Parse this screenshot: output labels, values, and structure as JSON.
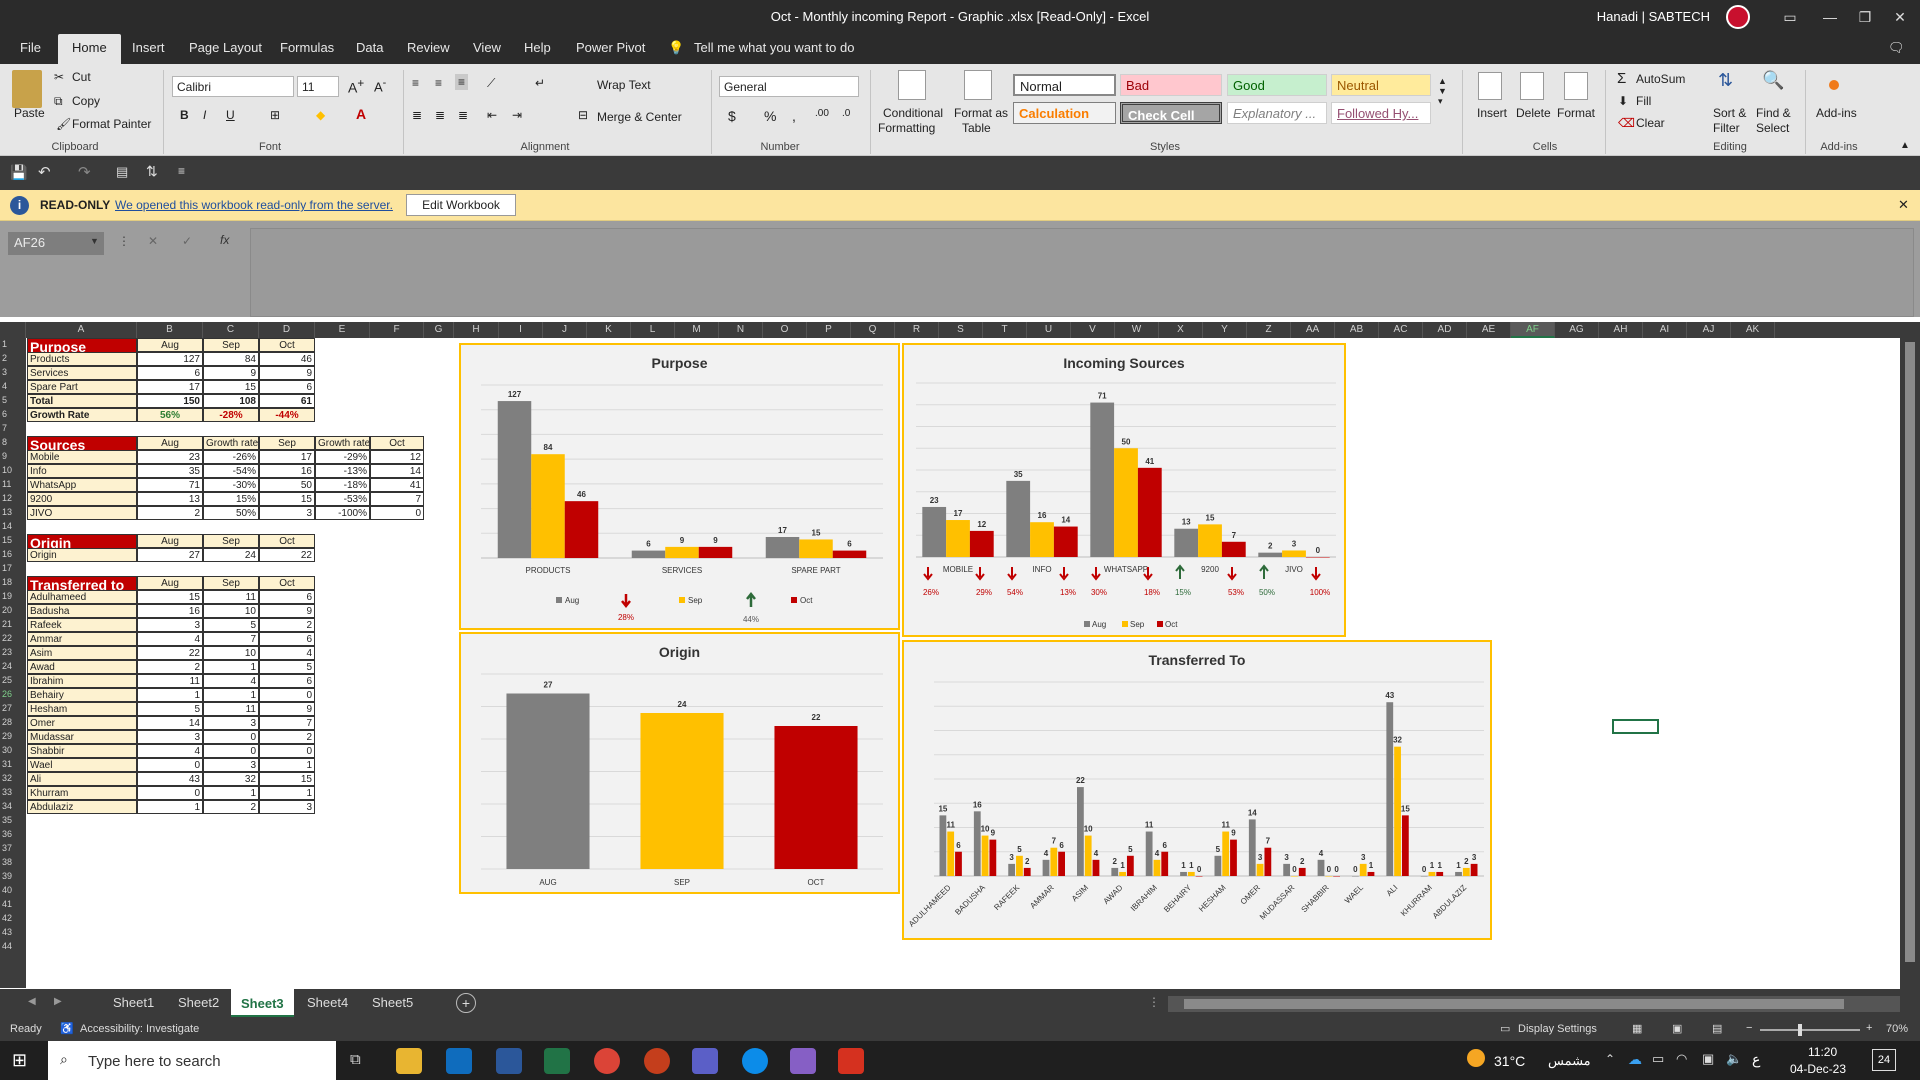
{
  "window": {
    "title": "Oct - Monthly incoming Report - Graphic .xlsx  [Read-Only]  - Excel",
    "user": "Hanadi | SABTECH"
  },
  "ribbon_tabs": [
    "File",
    "Home",
    "Insert",
    "Page Layout",
    "Formulas",
    "Data",
    "Review",
    "View",
    "Help",
    "Power Pivot",
    "Tell me what you want to do"
  ],
  "clipboard": {
    "paste": "Paste",
    "cut": "Cut",
    "copy": "Copy",
    "format_painter": "Format Painter",
    "label": "Clipboard"
  },
  "font": {
    "name": "Calibri",
    "size": "11",
    "label": "Font"
  },
  "alignment": {
    "wrap": "Wrap Text",
    "merge": "Merge & Center",
    "label": "Alignment"
  },
  "number": {
    "format": "General",
    "label": "Number"
  },
  "styles": {
    "conditional": "Conditional",
    "formatting": "Formatting",
    "format_as": "Format as",
    "table": "Table",
    "normal": "Normal",
    "bad": "Bad",
    "good": "Good",
    "neutral": "Neutral",
    "calculation": "Calculation",
    "check_cell": "Check Cell",
    "explanatory": "Explanatory ...",
    "followed": "Followed Hy...",
    "label": "Styles"
  },
  "cells": {
    "insert": "Insert",
    "delete": "Delete",
    "format": "Format",
    "label": "Cells"
  },
  "editing": {
    "autosum": "AutoSum",
    "fill": "Fill",
    "clear": "Clear",
    "sort": "Sort &",
    "filter": "Filter",
    "find": "Find &",
    "select": "Select",
    "label": "Editing"
  },
  "addins": {
    "addins": "Add-ins",
    "label": "Add-ins"
  },
  "message": {
    "tag": "READ-ONLY",
    "text": "We opened this workbook read-only from the server.",
    "button": "Edit Workbook"
  },
  "formula_bar": {
    "namebox": "AF26",
    "fx": "fx"
  },
  "columns": [
    "A",
    "B",
    "C",
    "D",
    "E",
    "F",
    "G",
    "H",
    "I",
    "J",
    "K",
    "L",
    "M",
    "N",
    "O",
    "P",
    "Q",
    "R",
    "S",
    "T",
    "U",
    "V",
    "W",
    "X",
    "Y",
    "Z",
    "AA",
    "AB",
    "AC",
    "AD",
    "AE",
    "AF",
    "AG",
    "AH",
    "AI",
    "AJ",
    "AK"
  ],
  "purpose_table": {
    "title": "Purpose",
    "headers": [
      "Aug",
      "Sep",
      "Oct"
    ],
    "rows": [
      [
        "Products",
        "127",
        "84",
        "46"
      ],
      [
        "Services",
        "6",
        "9",
        "9"
      ],
      [
        "Spare Part",
        "17",
        "15",
        "6"
      ],
      [
        "Total",
        "150",
        "108",
        "61"
      ],
      [
        "Growth Rate",
        "56%",
        "-28%",
        "-44%"
      ]
    ]
  },
  "sources_table": {
    "title": "Sources",
    "headers": [
      "Aug",
      "Growth rate",
      "Sep",
      "Growth rate",
      "Oct"
    ],
    "rows": [
      [
        "Mobile",
        "23",
        "-26%",
        "17",
        "-29%",
        "12"
      ],
      [
        "Info",
        "35",
        "-54%",
        "16",
        "-13%",
        "14"
      ],
      [
        "WhatsApp",
        "71",
        "-30%",
        "50",
        "-18%",
        "41"
      ],
      [
        "9200",
        "13",
        "15%",
        "15",
        "-53%",
        "7"
      ],
      [
        "JIVO",
        "2",
        "50%",
        "3",
        "-100%",
        "0"
      ]
    ]
  },
  "origin_table": {
    "title": "Origin",
    "headers": [
      "Aug",
      "Sep",
      "Oct"
    ],
    "rows": [
      [
        "Origin",
        "27",
        "24",
        "22"
      ]
    ]
  },
  "transfer_table": {
    "title": "Transferred to",
    "headers": [
      "Aug",
      "Sep",
      "Oct"
    ],
    "rows": [
      [
        "Adulhameed",
        "15",
        "11",
        "6"
      ],
      [
        "Badusha",
        "16",
        "10",
        "9"
      ],
      [
        "Rafeek",
        "3",
        "5",
        "2"
      ],
      [
        "Ammar",
        "4",
        "7",
        "6"
      ],
      [
        "Asim",
        "22",
        "10",
        "4"
      ],
      [
        "Awad",
        "2",
        "1",
        "5"
      ],
      [
        "Ibrahim",
        "11",
        "4",
        "6"
      ],
      [
        "Behairy",
        "1",
        "1",
        "0"
      ],
      [
        "Hesham",
        "5",
        "11",
        "9"
      ],
      [
        "Omer",
        "14",
        "3",
        "7"
      ],
      [
        "Mudassar",
        "3",
        "0",
        "2"
      ],
      [
        "Shabbir",
        "4",
        "0",
        "0"
      ],
      [
        "Wael",
        "0",
        "3",
        "1"
      ],
      [
        "Ali",
        "43",
        "32",
        "15"
      ],
      [
        "Khurram",
        "0",
        "1",
        "1"
      ],
      [
        "Abdulaziz",
        "1",
        "2",
        "3"
      ]
    ]
  },
  "colors": {
    "aug": "#7f7f7f",
    "sep": "#ffc000",
    "oct": "#c00000",
    "up": "#2e6b3a",
    "down": "#c00000"
  },
  "chart_data": [
    {
      "type": "bar",
      "title": "Purpose",
      "categories": [
        "PRODUCTS",
        "SERVICES",
        "SPARE PART"
      ],
      "series": [
        {
          "name": "Aug",
          "values": [
            127,
            6,
            17
          ]
        },
        {
          "name": "Sep",
          "values": [
            84,
            9,
            15
          ]
        },
        {
          "name": "Oct",
          "values": [
            46,
            9,
            6
          ]
        }
      ],
      "annotations": [
        {
          "text": "28%",
          "direction": "down"
        },
        {
          "text": "44%",
          "direction": "up"
        }
      ],
      "ylim": [
        0,
        140
      ]
    },
    {
      "type": "bar",
      "title": "Incoming Sources",
      "categories": [
        "MOBILE",
        "INFO",
        "WHATSAPP",
        "9200",
        "JIVO"
      ],
      "series": [
        {
          "name": "Aug",
          "values": [
            23,
            35,
            71,
            13,
            2
          ]
        },
        {
          "name": "Sep",
          "values": [
            17,
            16,
            50,
            15,
            3
          ]
        },
        {
          "name": "Oct",
          "values": [
            12,
            14,
            41,
            7,
            0
          ]
        }
      ],
      "annotations": [
        [
          "26%",
          "29%"
        ],
        [
          "54%",
          "13%"
        ],
        [
          "30%",
          "18%"
        ],
        [
          "15%",
          "53%"
        ],
        [
          "50%",
          "100%"
        ]
      ],
      "ylim": [
        0,
        80
      ]
    },
    {
      "type": "bar",
      "title": "Origin",
      "categories": [
        "AUG",
        "SEP",
        "OCT"
      ],
      "values": [
        27,
        24,
        22
      ],
      "ylim": [
        0,
        30
      ]
    },
    {
      "type": "bar",
      "title": "Transferred To",
      "categories": [
        "ADULHAMEED",
        "BADUSHA",
        "RAFEEK",
        "AMMAR",
        "ASIM",
        "AWAD",
        "IBRAHIM",
        "BEHAIRY",
        "HESHAM",
        "OMER",
        "MUDASSAR",
        "SHABBIR",
        "WAEL",
        "ALI",
        "KHURRAM",
        "ABDULAZIZ"
      ],
      "series": [
        {
          "name": "Aug",
          "values": [
            15,
            16,
            3,
            4,
            22,
            2,
            11,
            1,
            5,
            14,
            3,
            4,
            0,
            43,
            0,
            1
          ]
        },
        {
          "name": "Sep",
          "values": [
            11,
            10,
            5,
            7,
            10,
            1,
            4,
            1,
            11,
            3,
            0,
            0,
            3,
            32,
            1,
            2
          ]
        },
        {
          "name": "Oct",
          "values": [
            6,
            9,
            2,
            6,
            4,
            5,
            6,
            0,
            9,
            7,
            2,
            0,
            1,
            15,
            1,
            3
          ]
        }
      ],
      "ylim": [
        0,
        48
      ]
    }
  ],
  "sheets": [
    "Sheet1",
    "Sheet2",
    "Sheet3",
    "Sheet4",
    "Sheet5"
  ],
  "status": {
    "ready": "Ready",
    "accessibility": "Accessibility: Investigate",
    "display": "Display Settings",
    "zoom": "70%"
  },
  "taskbar": {
    "search": "Type here to search",
    "weather": "31°C",
    "weather_ar": "مشمس",
    "time": "11:20",
    "date": "04-Dec-23",
    "lang": "ع",
    "notif": "24"
  }
}
